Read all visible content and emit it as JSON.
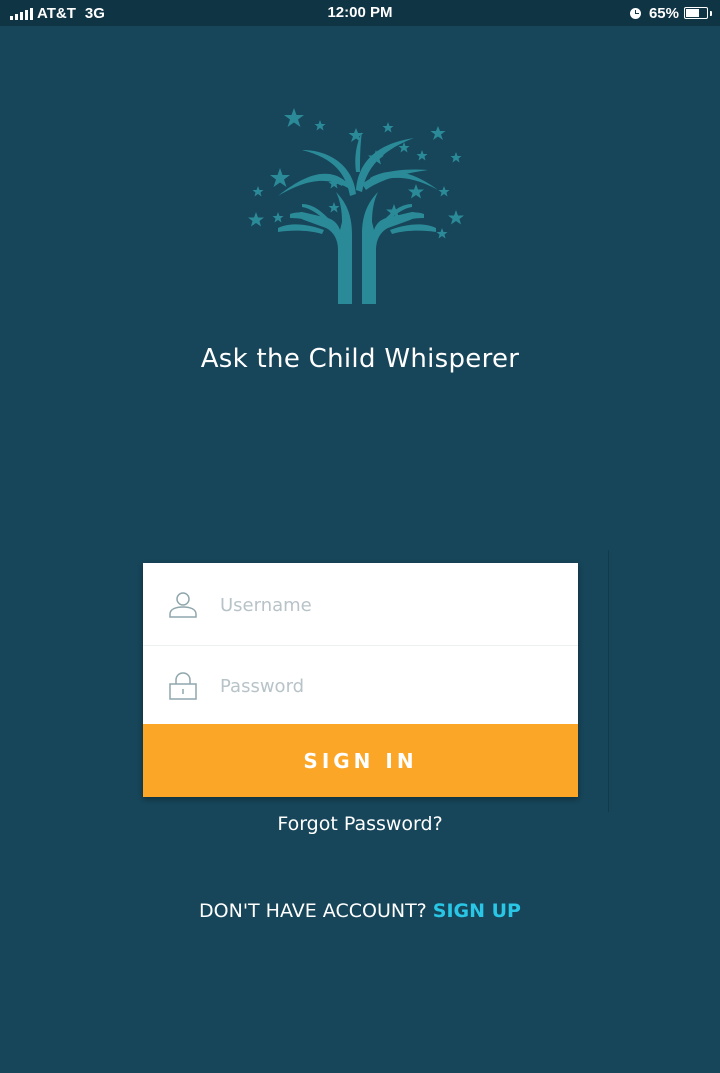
{
  "status_bar": {
    "carrier": "AT&T",
    "network": "3G",
    "time": "12:00 PM",
    "battery_percent": "65%",
    "battery_level": 0.65
  },
  "app": {
    "title": "Ask the Child Whisperer",
    "logo": "tree-hands-stars-icon"
  },
  "login": {
    "username_placeholder": "Username",
    "password_placeholder": "Password",
    "username_icon": "user-icon",
    "password_icon": "lock-icon",
    "signin_label": "SIGN IN",
    "forgot_label": "Forgot Password?"
  },
  "signup": {
    "prompt": "DON'T HAVE ACCOUNT?",
    "link_label": "SIGN UP"
  },
  "colors": {
    "background": "#174559",
    "status_bar": "#0f3444",
    "logo": "#2b8a98",
    "button": "#fba626",
    "link": "#29c6e6"
  }
}
